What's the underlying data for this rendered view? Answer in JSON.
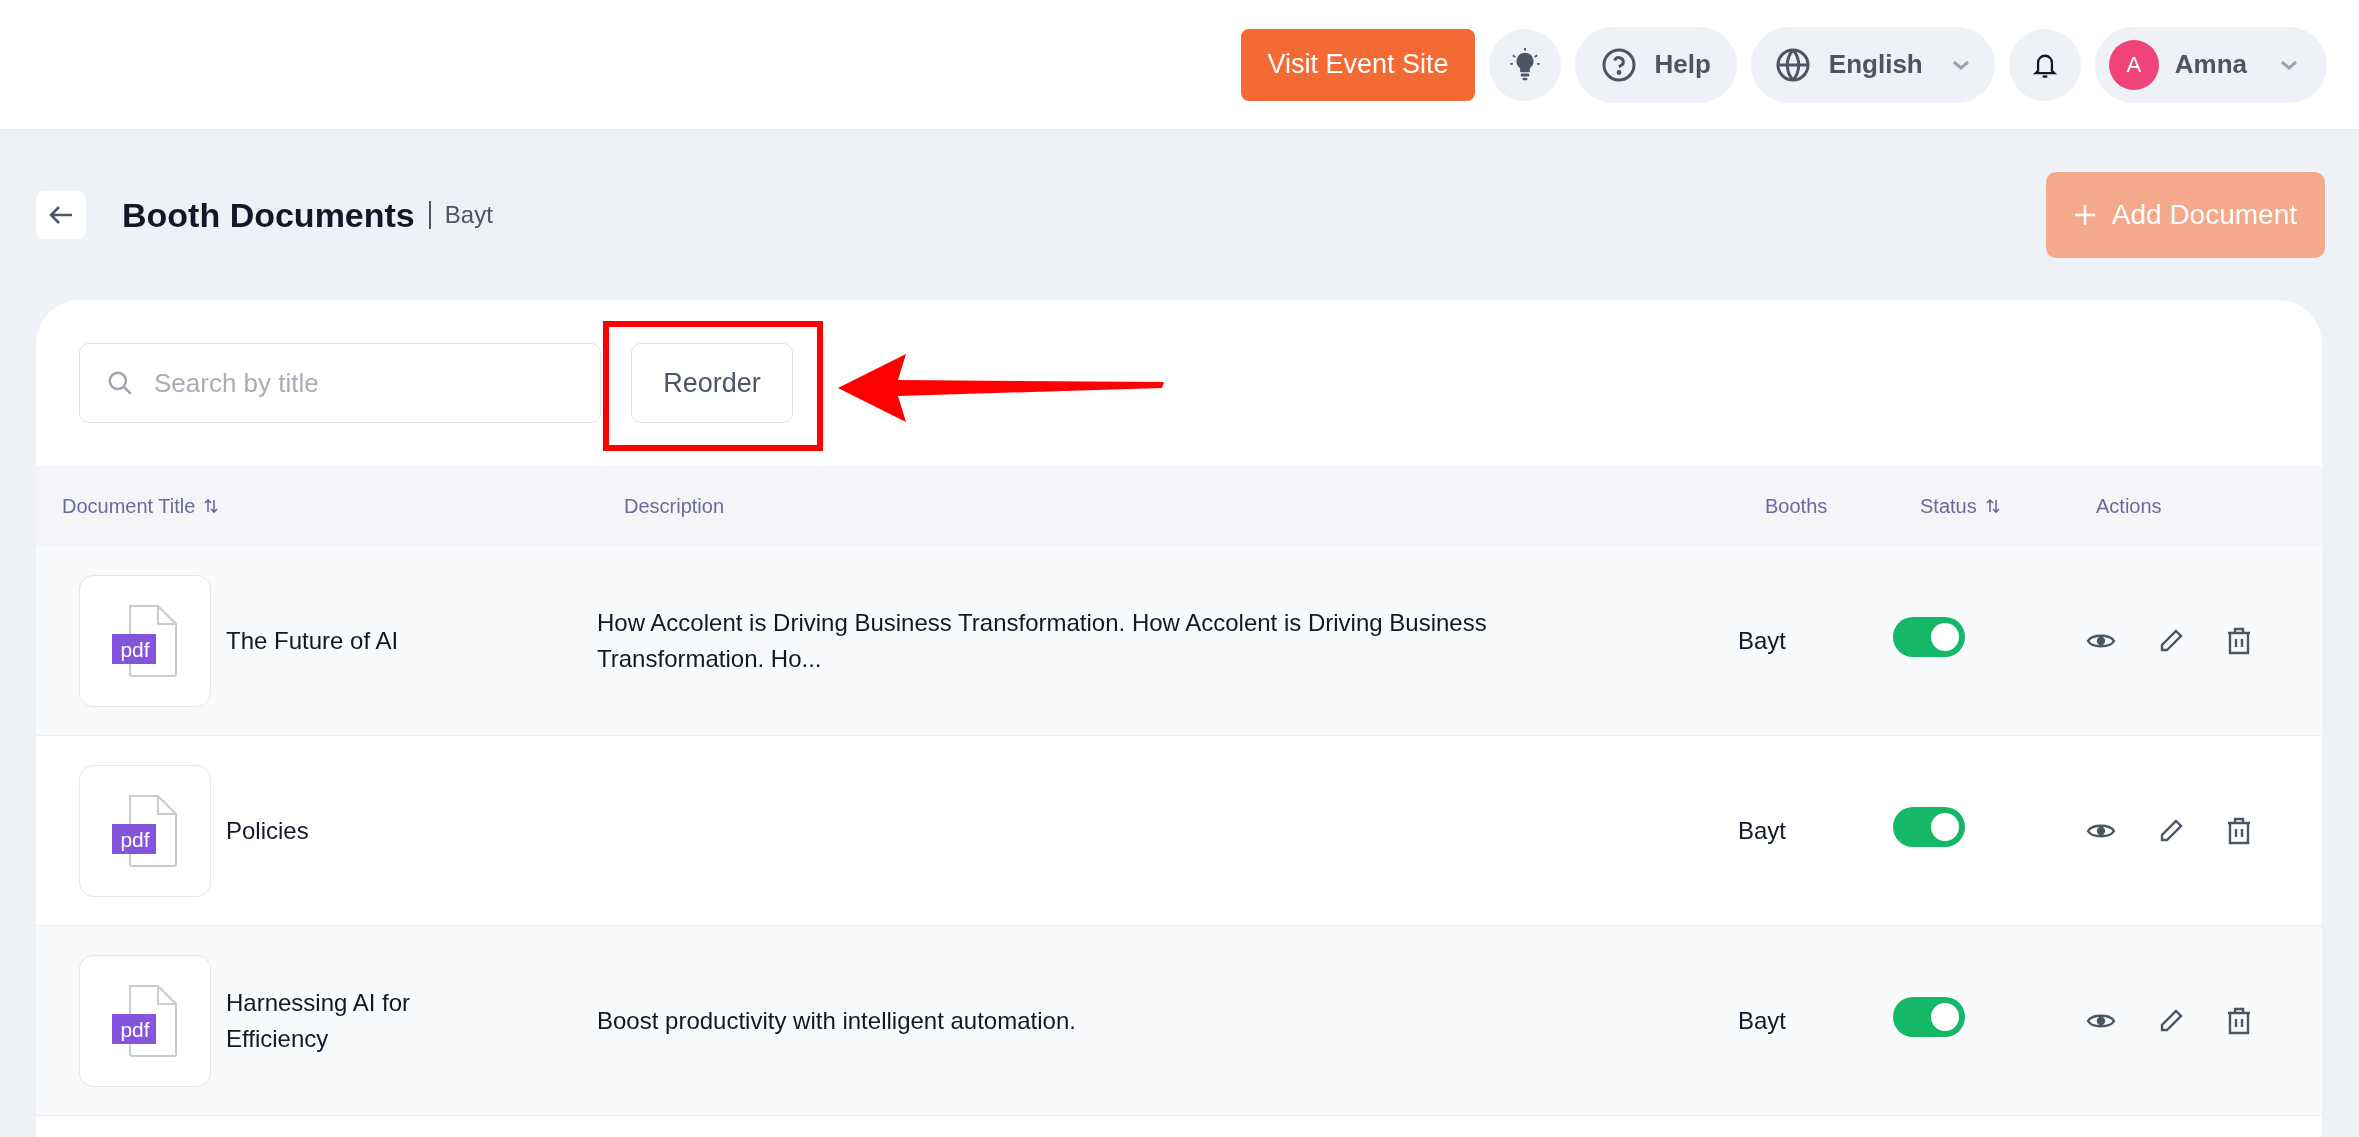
{
  "header": {
    "visit_button": "Visit Event Site",
    "help": "Help",
    "language": "English",
    "user": {
      "initial": "A",
      "name": "Amna"
    }
  },
  "page": {
    "title": "Booth Documents",
    "subtitle": "Bayt",
    "add_button": {
      "label": "Add Document",
      "disabled": true
    }
  },
  "toolbar": {
    "search": {
      "placeholder": "Search by title"
    },
    "reorder_button": "Reorder"
  },
  "table": {
    "columns": [
      {
        "label": "Document Title",
        "sortable": true
      },
      {
        "label": "Description",
        "sortable": false
      },
      {
        "label": "Booths",
        "sortable": false
      },
      {
        "label": "Status",
        "sortable": true
      },
      {
        "label": "Actions",
        "sortable": false
      }
    ],
    "rows": [
      {
        "file_type": "pdf",
        "title": "The Future of AI",
        "description": "How Accolent is Driving Business Transformation. How Accolent is Driving Business Transformation. Ho...",
        "booths": "Bayt",
        "on": true
      },
      {
        "file_type": "pdf",
        "title": "Policies",
        "booths": "Bayt",
        "on": true
      },
      {
        "file_type": "pdf",
        "title": "Harnessing AI for Efficiency",
        "description": "Boost productivity with intelligent automation.",
        "booths": "Bayt",
        "on": true
      }
    ]
  }
}
